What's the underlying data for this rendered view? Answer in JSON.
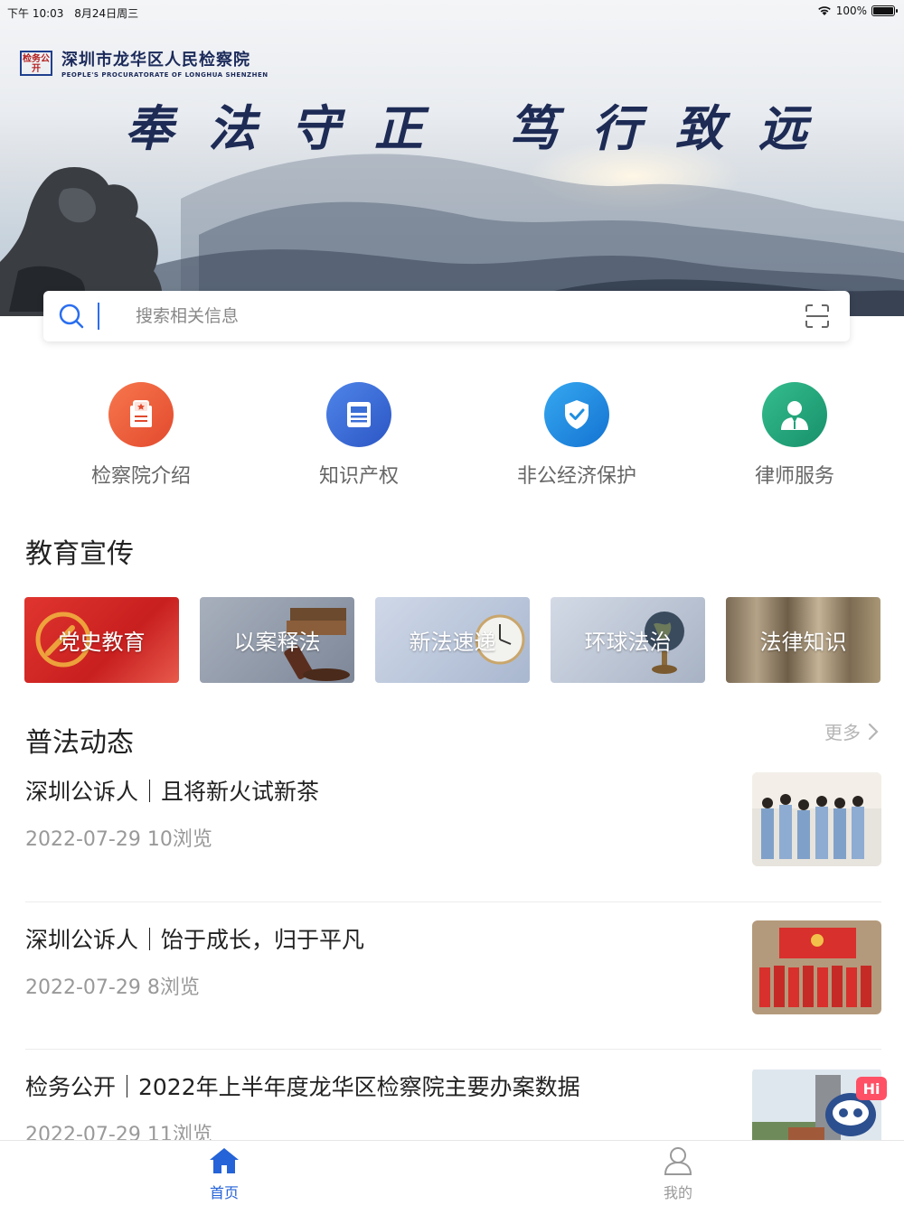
{
  "status_bar": {
    "time": "下午 10:03",
    "date": "8月24日周三",
    "battery": "100%"
  },
  "banner": {
    "org_name": "深圳市龙华区人民检察院",
    "org_name_en": "PEOPLE'S PROCURATORATE OF LONGHUA SHENZHEN",
    "seal_text": "检务公开",
    "slogan": "奉法守正 笃行致远"
  },
  "search": {
    "placeholder": "搜索相关信息"
  },
  "quick_menu": [
    {
      "label": "检察院介绍",
      "icon": "institution-icon",
      "color": "#ef5b3b"
    },
    {
      "label": "知识产权",
      "icon": "document-icon",
      "color": "#3b6fd8"
    },
    {
      "label": "非公经济保护",
      "icon": "shield-check-icon",
      "color": "#1e8fe0"
    },
    {
      "label": "律师服务",
      "icon": "lawyer-icon",
      "color": "#22a37a"
    }
  ],
  "education": {
    "title": "教育宣传",
    "cards": [
      {
        "label": "党史教育",
        "color": "#d8312c"
      },
      {
        "label": "以案释法",
        "color": "#8a95a8"
      },
      {
        "label": "新法速递",
        "color": "#b9c6dc"
      },
      {
        "label": "环球法治",
        "color": "#b8c4d6"
      },
      {
        "label": "法律知识",
        "color": "#9a8a74"
      }
    ]
  },
  "news_section": {
    "title": "普法动态",
    "more_label": "更多",
    "items": [
      {
        "title": "深圳公诉人｜且将新火试新茶",
        "date": "2022-07-29",
        "views": "10浏览"
      },
      {
        "title": "深圳公诉人｜饴于成长，归于平凡",
        "date": "2022-07-29",
        "views": "8浏览"
      },
      {
        "title": "检务公开｜2022年上半年度龙华区检察院主要办案数据",
        "date": "2022-07-29",
        "views": "11浏览"
      }
    ],
    "thumb_badge": "Hi"
  },
  "tab_bar": {
    "items": [
      {
        "label": "首页",
        "icon": "home-icon",
        "active": true
      },
      {
        "label": "我的",
        "icon": "user-icon",
        "active": false
      }
    ],
    "active_color": "#2563d8",
    "inactive_color": "#999999"
  }
}
